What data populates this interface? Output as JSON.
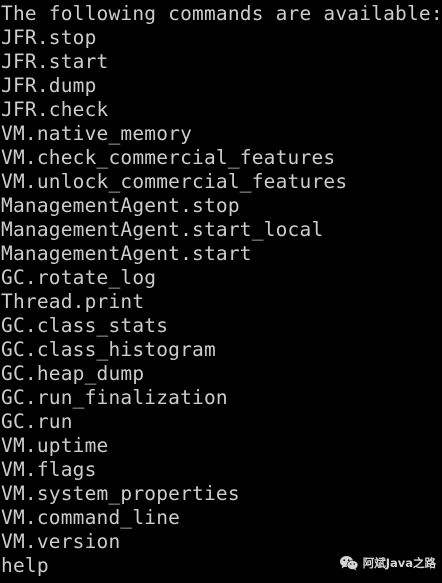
{
  "console": {
    "lines": [
      "The following commands are available:",
      "JFR.stop",
      "JFR.start",
      "JFR.dump",
      "JFR.check",
      "VM.native_memory",
      "VM.check_commercial_features",
      "VM.unlock_commercial_features",
      "ManagementAgent.stop",
      "ManagementAgent.start_local",
      "ManagementAgent.start",
      "GC.rotate_log",
      "Thread.print",
      "GC.class_stats",
      "GC.class_histogram",
      "GC.heap_dump",
      "GC.run_finalization",
      "GC.run",
      "VM.uptime",
      "VM.flags",
      "VM.system_properties",
      "VM.command_line",
      "VM.version",
      "help"
    ]
  },
  "watermark": {
    "icon": "wechat-icon",
    "text": "阿斌Java之路"
  },
  "colors": {
    "background": "#000000",
    "text": "#cccccc"
  }
}
